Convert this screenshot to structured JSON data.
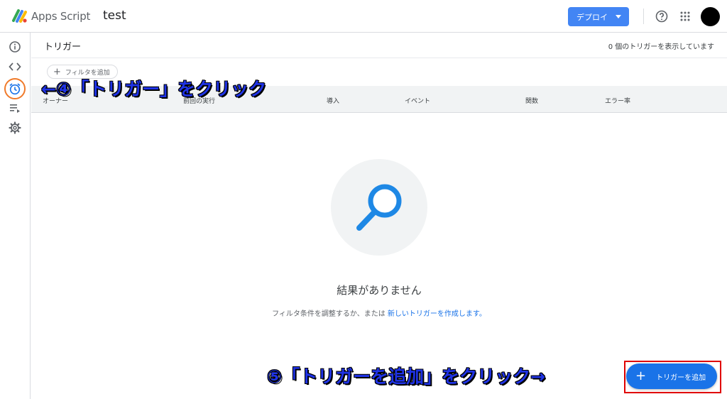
{
  "app": {
    "name": "Apps Script",
    "project": "test"
  },
  "topbar": {
    "deploy_label": "デプロイ",
    "help_icon": "help-circle-icon",
    "apps_icon": "apps-grid-icon"
  },
  "rail": {
    "items": [
      {
        "icon": "info-icon"
      },
      {
        "icon": "code-icon"
      },
      {
        "icon": "alarm-clock-icon"
      },
      {
        "icon": "playlist-icon"
      },
      {
        "icon": "gear-icon"
      }
    ]
  },
  "page": {
    "title": "トリガー",
    "count_text": "0 個のトリガーを表示しています",
    "filter_label": "フィルタを追加"
  },
  "table": {
    "columns": [
      "オーナー",
      "前回の実行",
      "導入",
      "イベント",
      "関数",
      "エラー率"
    ]
  },
  "empty_state": {
    "title": "結果がありません",
    "subtitle_prefix": "フィルタ条件を調整するか、または ",
    "subtitle_link": "新しいトリガーを作成します。"
  },
  "fab": {
    "label": "トリガーを追加"
  },
  "annotations": {
    "step4": "←④「トリガー」をクリック",
    "step5": "⑤「トリガーを追加」をクリック→"
  },
  "colors": {
    "primary": "#1a73e8",
    "deploy": "#4285f4",
    "highlight_orange": "#f07a2a",
    "highlight_red": "#e00000",
    "annotation_blue": "#1f33e6"
  }
}
